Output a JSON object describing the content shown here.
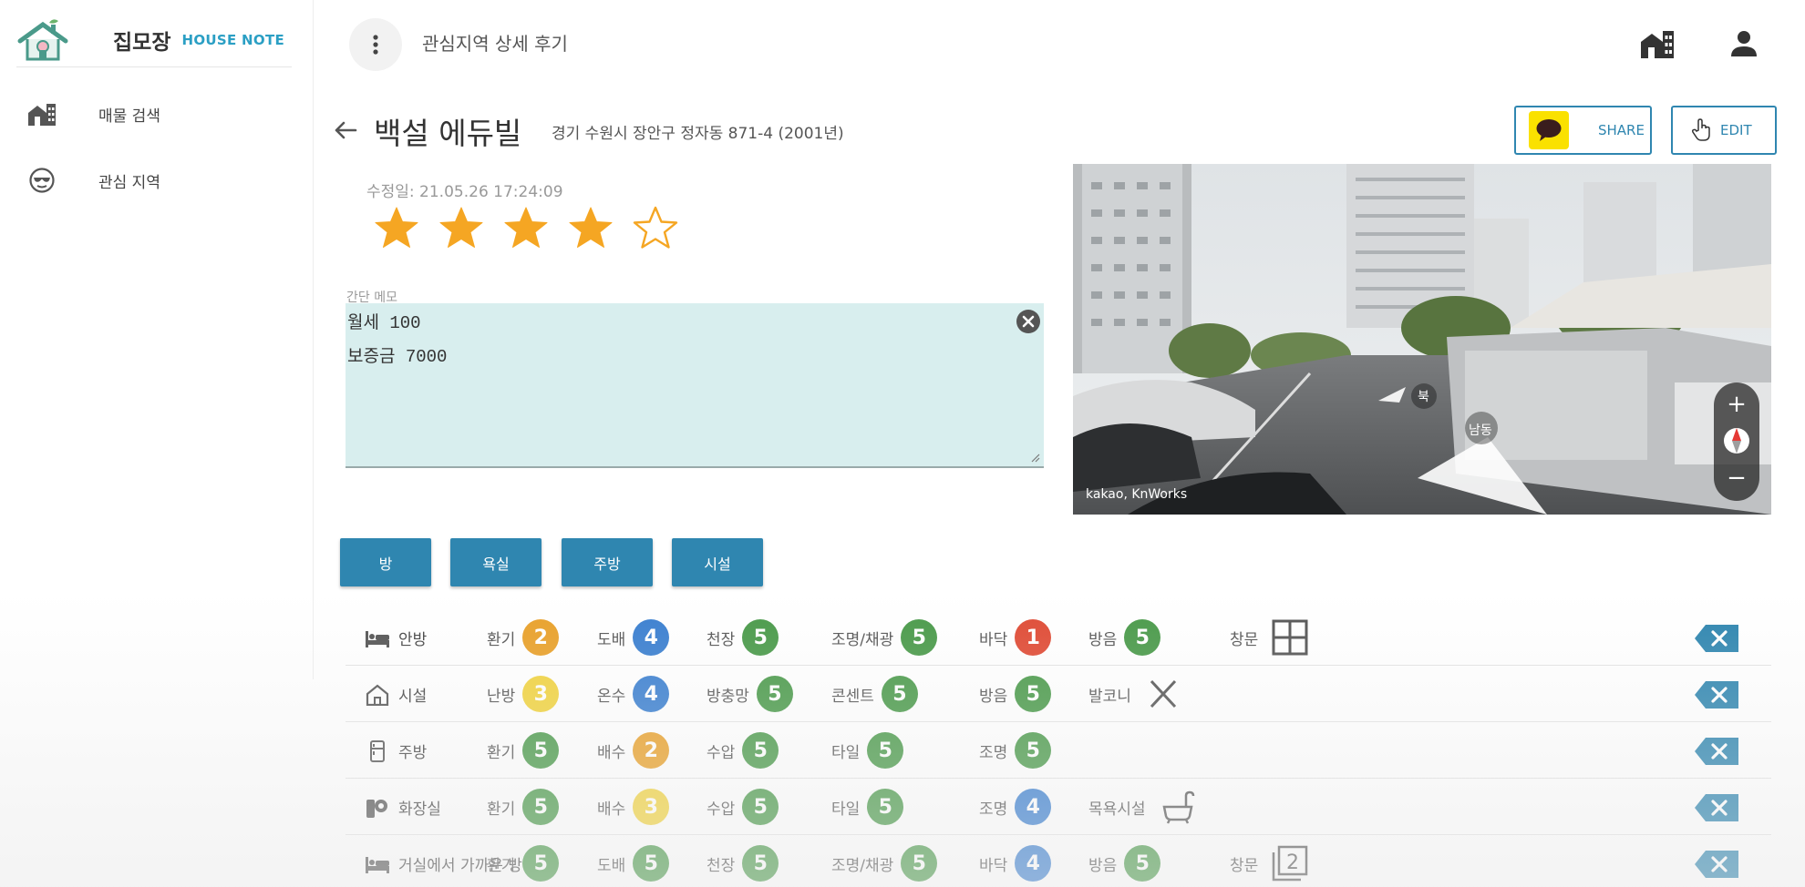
{
  "brand": {
    "name": "집모장",
    "sub": "HOUSE NOTE"
  },
  "sidebar": {
    "items": [
      {
        "label": "매물 검색",
        "icon": "building-icon"
      },
      {
        "label": "관심 지역",
        "icon": "sunglasses-face-icon"
      }
    ]
  },
  "header": {
    "title": "관심지역 상세 후기"
  },
  "property": {
    "name": "백설 에듀빌",
    "address": "경기 수원시 장안구 정자동 871-4 (2001년)",
    "modified": "수정일: 21.05.26 17:24:09",
    "rating": 4,
    "rating_max": 5
  },
  "actions": {
    "share_label": "SHARE",
    "edit_label": "EDIT"
  },
  "memo": {
    "label": "간단 메모",
    "value": "월세 100\n보증금 7000"
  },
  "streetview": {
    "brand": "kakao, KnWorks",
    "dir_north": "북",
    "dir_south_east": "남동",
    "zoom_in": "+",
    "zoom_out": "−"
  },
  "categories": [
    "방",
    "욕실",
    "주방",
    "시설"
  ],
  "colors": {
    "primary": "#2f86b0",
    "score_5": "#4a9a4a",
    "score_4": "#3a7fd0",
    "score_3": "#f1d33e",
    "score_2": "#e9a12a",
    "score_1": "#e04b35"
  },
  "rows": [
    {
      "name": "안방",
      "icon": "bed-icon",
      "cells": [
        {
          "label": "환기",
          "score": "2"
        },
        {
          "label": "도배",
          "score": "4"
        },
        {
          "label": "천장",
          "score": "5"
        },
        {
          "label": "조명/채광",
          "score": "5"
        },
        {
          "label": "바닥",
          "score": "1"
        },
        {
          "label": "방음",
          "score": "5"
        },
        {
          "label": "창문",
          "icon": "window-icon"
        }
      ]
    },
    {
      "name": "시설",
      "icon": "home-icon",
      "cells": [
        {
          "label": "난방",
          "score": "3"
        },
        {
          "label": "온수",
          "score": "4"
        },
        {
          "label": "방충망",
          "score": "5"
        },
        {
          "label": "콘센트",
          "score": "5"
        },
        {
          "label": "방음",
          "score": "5"
        },
        {
          "label": "발코니",
          "icon": "x-mark-icon"
        }
      ]
    },
    {
      "name": "주방",
      "icon": "fridge-icon",
      "cells": [
        {
          "label": "환기",
          "score": "5"
        },
        {
          "label": "배수",
          "score": "2"
        },
        {
          "label": "수압",
          "score": "5"
        },
        {
          "label": "타일",
          "score": "5"
        },
        {
          "label": "조명",
          "score": "5"
        }
      ]
    },
    {
      "name": "화장실",
      "icon": "toilet-icon",
      "cells": [
        {
          "label": "환기",
          "score": "5"
        },
        {
          "label": "배수",
          "score": "3"
        },
        {
          "label": "수압",
          "score": "5"
        },
        {
          "label": "타일",
          "score": "5"
        },
        {
          "label": "조명",
          "score": "4"
        },
        {
          "label": "목욕시설",
          "icon": "bathtub-icon"
        }
      ]
    },
    {
      "name": "거실에서 가까운 방",
      "icon": "bed-icon",
      "cells": [
        {
          "label": "환기",
          "score": "5"
        },
        {
          "label": "도배",
          "score": "5"
        },
        {
          "label": "천장",
          "score": "5"
        },
        {
          "label": "조명/채광",
          "score": "5"
        },
        {
          "label": "바닥",
          "score": "4"
        },
        {
          "label": "방음",
          "score": "5"
        },
        {
          "label": "창문",
          "icon": "window-double-icon"
        }
      ]
    }
  ]
}
